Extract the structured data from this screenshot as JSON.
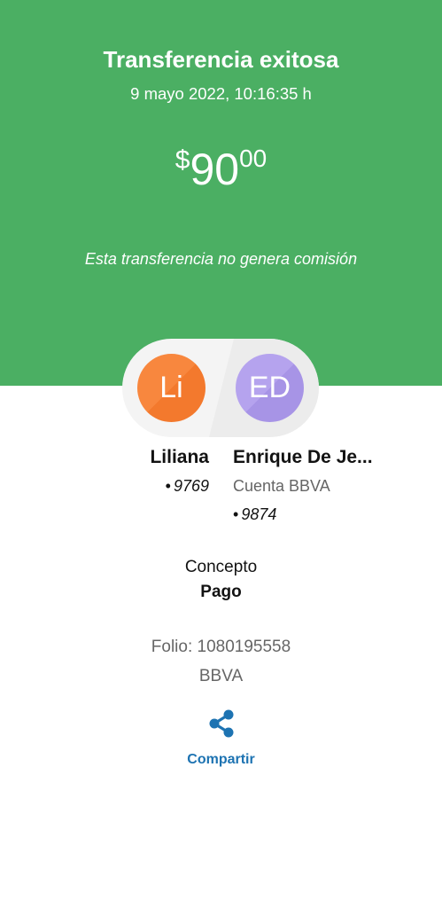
{
  "header": {
    "title": "Transferencia exitosa",
    "datetime": "9 mayo 2022, 10:16:35 h",
    "amount": {
      "currency": "$",
      "integer": "90",
      "decimals": "00"
    },
    "fee_note": "Esta transferencia no genera comisión",
    "background_color": "#4baf63"
  },
  "sender": {
    "initials": "Li",
    "name": "Liliana",
    "account_mask": "•",
    "account": "9769",
    "avatar_color": "#f3792d"
  },
  "recipient": {
    "initials": "ED",
    "name": "Enrique De Je...",
    "bank_label": "Cuenta BBVA",
    "account_mask": "•",
    "account": "9874",
    "avatar_color": "#a794e6"
  },
  "details": {
    "concept_label": "Concepto",
    "concept_value": "Pago",
    "folio": "Folio: 1080195558",
    "bank": "BBVA"
  },
  "actions": {
    "share_icon": "share-icon",
    "share_label": "Compartir",
    "accent_color": "#1d73b2"
  }
}
